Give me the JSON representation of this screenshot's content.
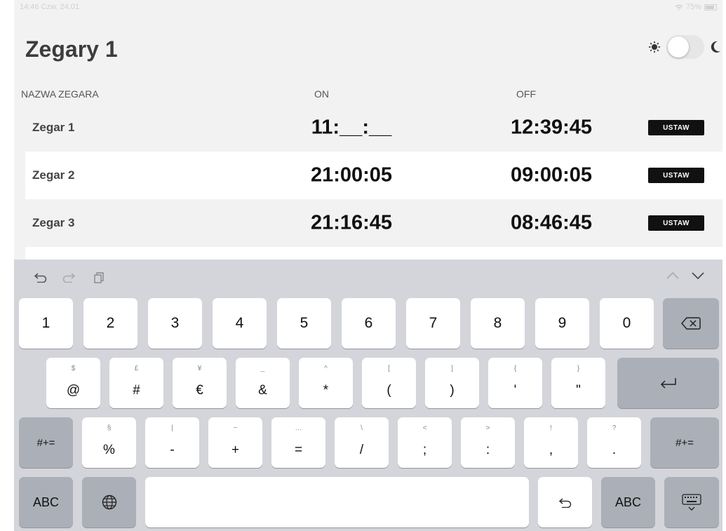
{
  "status_bar": {
    "time_date": "14:46  Czw. 24.01",
    "battery": "75%"
  },
  "page": {
    "title": "Zegary 1"
  },
  "table": {
    "headers": {
      "name": "NAZWA ZEGARA",
      "on": "ON",
      "off": "OFF"
    },
    "rows": [
      {
        "name": "Zegar 1",
        "on": "11:__:__",
        "off": "12:39:45",
        "button": "USTAW"
      },
      {
        "name": "Zegar 2",
        "on": "21:00:05",
        "off": "09:00:05",
        "button": "USTAW"
      },
      {
        "name": "Zegar 3",
        "on": "21:16:45",
        "off": "08:46:45",
        "button": "USTAW"
      }
    ]
  },
  "keyboard": {
    "row1": [
      "1",
      "2",
      "3",
      "4",
      "5",
      "6",
      "7",
      "8",
      "9",
      "0"
    ],
    "row2": [
      {
        "main": "@",
        "sub": "$"
      },
      {
        "main": "#",
        "sub": "£"
      },
      {
        "main": "€",
        "sub": "¥"
      },
      {
        "main": "&",
        "sub": "_"
      },
      {
        "main": "*",
        "sub": "^"
      },
      {
        "main": "(",
        "sub": "["
      },
      {
        "main": ")",
        "sub": "]"
      },
      {
        "main": "'",
        "sub": "{"
      },
      {
        "main": "\"",
        "sub": "}"
      }
    ],
    "row3": [
      {
        "main": "%",
        "sub": "§"
      },
      {
        "main": "-",
        "sub": "|"
      },
      {
        "main": "+",
        "sub": "~"
      },
      {
        "main": "=",
        "sub": "…"
      },
      {
        "main": "/",
        "sub": "\\"
      },
      {
        "main": ";",
        "sub": "<"
      },
      {
        "main": ":",
        "sub": ">"
      },
      {
        "main": ",",
        "sub": "!"
      },
      {
        "main": ".",
        "sub": "?"
      }
    ],
    "shift_label": "#+=",
    "abc_label": "ABC"
  }
}
